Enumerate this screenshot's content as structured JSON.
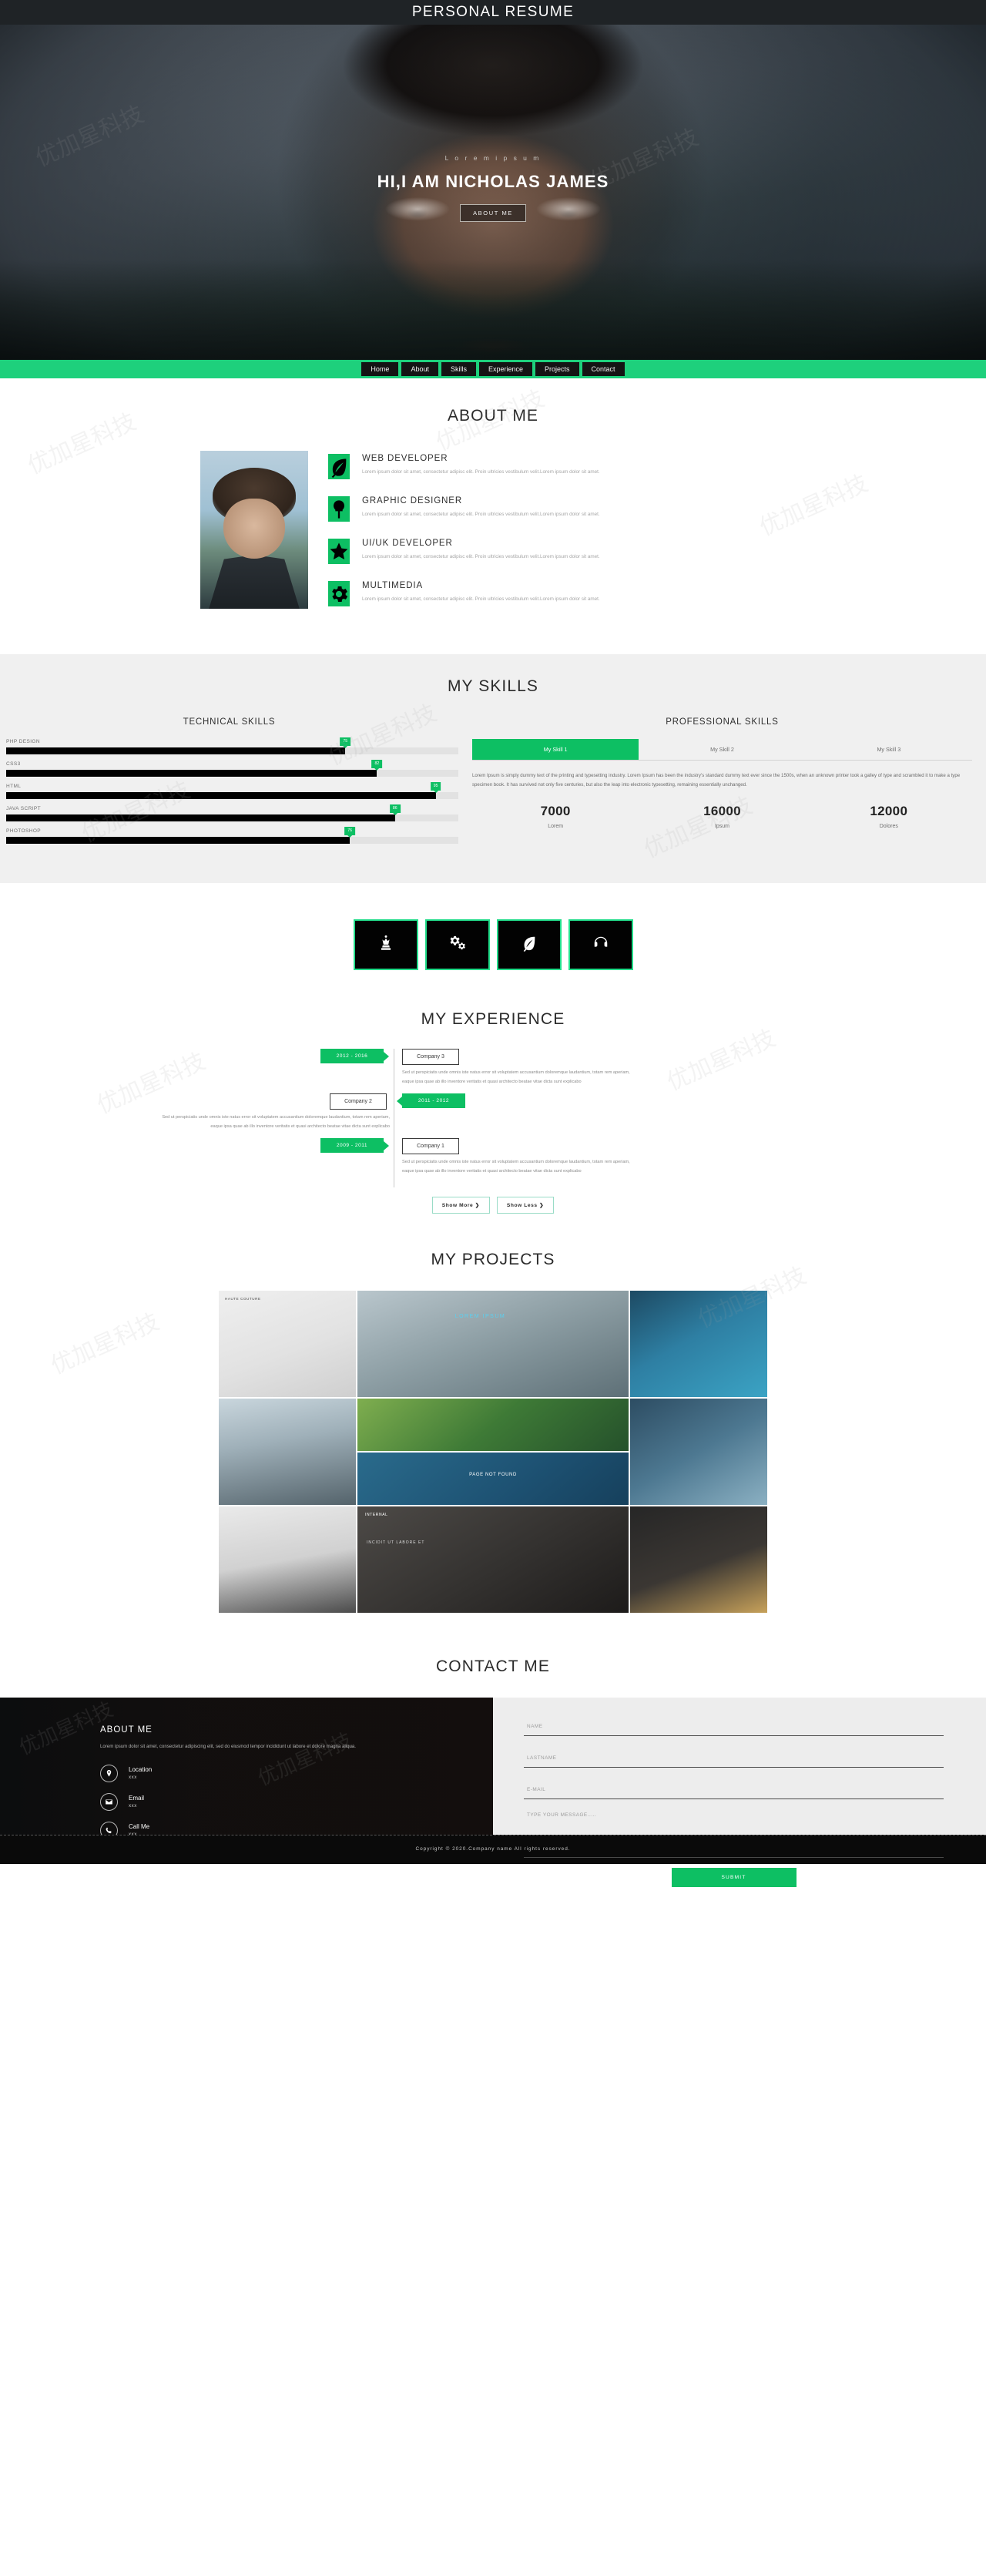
{
  "topbar": {
    "title": "PERSONAL RESUME"
  },
  "hero": {
    "subtitle": "L o r e m   i p s u m",
    "title": "HI,I AM NICHOLAS JAMES",
    "button": "ABOUT ME"
  },
  "nav": {
    "items": [
      {
        "label": "Home"
      },
      {
        "label": "About"
      },
      {
        "label": "Skills"
      },
      {
        "label": "Experience"
      },
      {
        "label": "Projects"
      },
      {
        "label": "Contact"
      }
    ]
  },
  "about": {
    "title": "ABOUT ME",
    "services": [
      {
        "icon": "leaf-icon",
        "title": "WEB DEVELOPER",
        "desc": "Lorem ipsum dolor sit amet, consectetur adipisc elit. Proin ultricies vestibulum velit.Lorem ipsum dolor sit amet."
      },
      {
        "icon": "tree-icon",
        "title": "GRAPHIC DESIGNER",
        "desc": "Lorem ipsum dolor sit amet, consectetur adipisc elit. Proin ultricies vestibulum velit.Lorem ipsum dolor sit amet."
      },
      {
        "icon": "star-icon",
        "title": "UI/UK DEVELOPER",
        "desc": "Lorem ipsum dolor sit amet, consectetur adipisc elit. Proin ultricies vestibulum velit.Lorem ipsum dolor sit amet."
      },
      {
        "icon": "gear-icon",
        "title": "MULTIMEDIA",
        "desc": "Lorem ipsum dolor sit amet, consectetur adipisc elit. Proin ultricies vestibulum velit.Lorem ipsum dolor sit amet."
      }
    ]
  },
  "skills": {
    "title": "MY SKILLS",
    "technical_heading": "TECHNICAL SKILLS",
    "professional_heading": "PROFESSIONAL SKILLS",
    "bars": [
      {
        "label": "PHP DESIGN",
        "value": 75
      },
      {
        "label": "CSS3",
        "value": 82
      },
      {
        "label": "HTML",
        "value": 95
      },
      {
        "label": "JAVA SCRIPT",
        "value": 86
      },
      {
        "label": "PHOTOSHOP",
        "value": 76
      }
    ],
    "tabs": [
      {
        "label": "My Skill 1",
        "active": true
      },
      {
        "label": "My Skill 2",
        "active": false
      },
      {
        "label": "My Skill 3",
        "active": false
      }
    ],
    "tab_body": "Lorem Ipsum is simply dummy text of the printing and typesetting industry. Lorem Ipsum has been the industry's standard dummy text ever since the 1500s, when an unknown printer took a galley of type and scrambled it to make a type specimen book. It has survived not only five centuries, but also the leap into electronic typesetting, remaining essentially unchanged.",
    "counters": [
      {
        "number": "7000",
        "label": "Lorem"
      },
      {
        "number": "16000",
        "label": "Ipsum"
      },
      {
        "number": "12000",
        "label": "Dolores"
      }
    ]
  },
  "icon_boxes": [
    {
      "icon": "chess-queen-icon"
    },
    {
      "icon": "cogs-icon"
    },
    {
      "icon": "leaf-icon"
    },
    {
      "icon": "headphones-icon"
    }
  ],
  "experience": {
    "title": "MY EXPERIENCE",
    "entries": [
      {
        "date": "2012 - 2016",
        "company": "Company 3",
        "side": "right",
        "text": "Sed ut perspiciatis unde omnis iste natus error sit voluptatem accusantium doloremque laudantium, totam rem aperiam, eaque ipsa quae ab illo inventore veritatis et quasi architecto beatae vitae dicta sunt explicabo"
      },
      {
        "date": "2011 - 2012",
        "company": "Company 2",
        "side": "left",
        "text": "Sed ut perspiciatis unde omnis iste natus error sit voluptatem accusantium doloremque laudantium, totam rem aperiam, eaque ipsa quae ab illo inventore veritatis et quasi architecto beatae vitae dicta sunt explicabo"
      },
      {
        "date": "2009 - 2011",
        "company": "Company 1",
        "side": "right",
        "text": "Sed ut perspiciatis unde omnis iste natus error sit voluptatem accusantium doloremque laudantium, totam rem aperiam, eaque ipsa quae ab illo inventore veritatis et quasi architecto beatae vitae dicta sunt explicabo"
      }
    ],
    "show_more": "Show More ❯",
    "show_less": "Show Less ❯"
  },
  "projects": {
    "title": "MY PROJECTS",
    "tiles": [
      {
        "caption": "HAUTE COUTURE"
      },
      {
        "caption": "LOREM IPSUM"
      },
      {
        "caption": ""
      },
      {
        "caption": ""
      },
      {
        "caption": ""
      },
      {
        "caption": "PAGE NOT FOUND"
      },
      {
        "caption": ""
      },
      {
        "caption": ""
      },
      {
        "caption": "INTERNAL"
      },
      {
        "caption": "INCIDIT UT LABORE ET"
      },
      {
        "caption": ""
      }
    ]
  },
  "contact": {
    "title": "CONTACT ME",
    "left": {
      "heading": "ABOUT ME",
      "desc": "Lorem ipsum dolor sit amet, consectetur adipiscing elit, sed do eiusmod tempor incididunt ut labore et dolore magna aliqua.",
      "items": [
        {
          "icon": "location-pin-icon",
          "label": "Location",
          "value": "xxx"
        },
        {
          "icon": "envelope-icon",
          "label": "Email",
          "value": "xxx"
        },
        {
          "icon": "phone-icon",
          "label": "Call Me",
          "value": "xxx"
        }
      ]
    },
    "form": {
      "name_placeholder": "NAME",
      "lastname_placeholder": "LASTNAME",
      "email_placeholder": "E-MAIL",
      "message_placeholder": "TYPE YOUR MESSAGE.....",
      "submit": "SUBMIT"
    }
  },
  "footer": {
    "text": "Copyright © 2020.Company name All rights reserved."
  },
  "colors": {
    "accent": "#0dbf63",
    "navbar": "#1ed07c",
    "dark": "#1f2326"
  },
  "watermark": "优加星科技"
}
